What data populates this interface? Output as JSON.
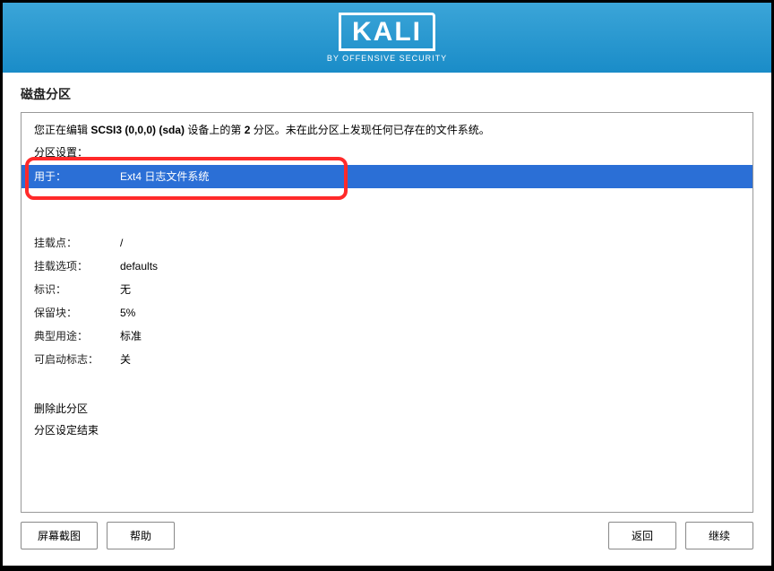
{
  "header": {
    "logo_text": "KALI",
    "logo_subtitle": "BY OFFENSIVE SECURITY"
  },
  "title": "磁盘分区",
  "info": {
    "prefix": "您正在编辑 ",
    "device": "SCSI3 (0,0,0) (sda)",
    "mid": " 设备上的第 ",
    "partnum": "2",
    "suffix": " 分区。未在此分区上发现任何已存在的文件系统。"
  },
  "section_label": "分区设置：",
  "rows": {
    "use_as": {
      "label": "用于：",
      "value": "Ext4 日志文件系统"
    },
    "mount_point": {
      "label": "挂载点：",
      "value": "/"
    },
    "mount_options": {
      "label": "挂载选项：",
      "value": "defaults"
    },
    "label_row": {
      "label": "标识：",
      "value": "无"
    },
    "reserved": {
      "label": "保留块：",
      "value": "5%"
    },
    "typical": {
      "label": "典型用途：",
      "value": "标准"
    },
    "bootable": {
      "label": "可启动标志：",
      "value": "关"
    }
  },
  "actions": {
    "delete": "删除此分区",
    "done": "分区设定结束"
  },
  "buttons": {
    "screenshot": "屏幕截图",
    "help": "帮助",
    "back": "返回",
    "continue": "继续"
  }
}
